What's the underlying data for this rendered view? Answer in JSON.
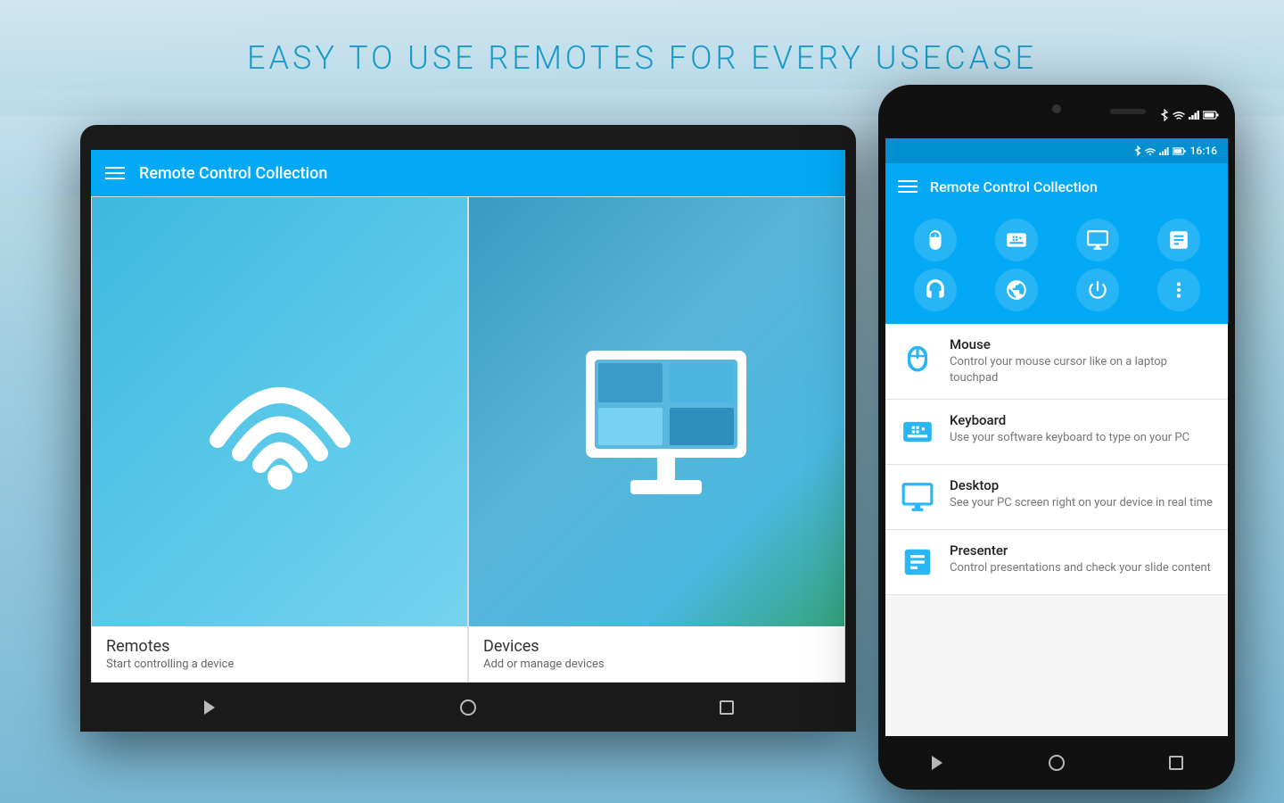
{
  "page": {
    "header_title": "EASY TO USE REMOTES FOR EVERY USECASE"
  },
  "tablet": {
    "app_title": "Remote Control Collection",
    "grid_items": [
      {
        "id": "remotes",
        "title": "Remotes",
        "subtitle": "Start controlling a device"
      },
      {
        "id": "devices",
        "title": "Devices",
        "subtitle": "Add or manage devices"
      }
    ]
  },
  "phone": {
    "status_time": "16:16",
    "app_title": "Remote Control Collection",
    "list_items": [
      {
        "id": "mouse",
        "title": "Mouse",
        "subtitle": "Control your mouse cursor like on a laptop touchpad"
      },
      {
        "id": "keyboard",
        "title": "Keyboard",
        "subtitle": "Use your software keyboard to type on your PC"
      },
      {
        "id": "desktop",
        "title": "Desktop",
        "subtitle": "See your PC screen right on your device in real time"
      },
      {
        "id": "presenter",
        "title": "Presenter",
        "subtitle": "Control presentations and check your slide content"
      }
    ]
  },
  "colors": {
    "primary_blue": "#03a9f4",
    "dark_blue": "#0390d0",
    "icon_blue": "#29b6f6",
    "text_dark": "#212121",
    "text_gray": "#757575"
  }
}
